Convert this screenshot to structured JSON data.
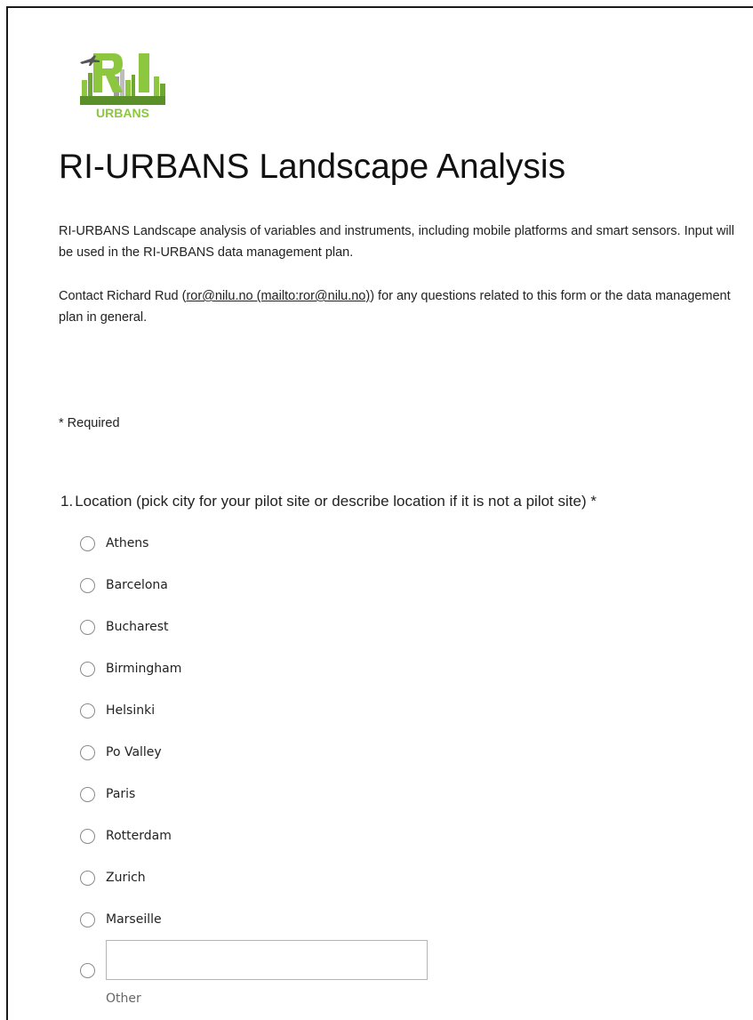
{
  "logo": {
    "initials": "RI",
    "wordmark": "URBANS",
    "icon": "ri-urbans-city-skyline-logo",
    "color_green": "#8dc63f",
    "color_dark_green": "#5a8f2a",
    "color_grey": "#8c8c8c"
  },
  "form": {
    "title": "RI-URBANS Landscape Analysis",
    "description": "RI-URBANS Landscape analysis of variables and instruments, including mobile platforms and smart sensors. Input will be used in the RI-URBANS data management plan.",
    "contact_prefix": "Contact Richard Rud (",
    "contact_link": "ror@nilu.no (mailto:ror@nilu.no)",
    "contact_suffix": ") for any questions related to this form or the data management plan in general.",
    "required_note": "* Required"
  },
  "question1": {
    "number": "1.",
    "text": "Location (pick city for your pilot site or describe location if it is not a pilot site) *",
    "options": [
      {
        "label": "Athens"
      },
      {
        "label": "Barcelona"
      },
      {
        "label": "Bucharest"
      },
      {
        "label": "Birmingham"
      },
      {
        "label": "Helsinki"
      },
      {
        "label": "Po Valley"
      },
      {
        "label": "Paris"
      },
      {
        "label": "Rotterdam"
      },
      {
        "label": "Zurich"
      },
      {
        "label": "Marseille"
      }
    ],
    "other": {
      "value": "",
      "label": "Other"
    }
  }
}
